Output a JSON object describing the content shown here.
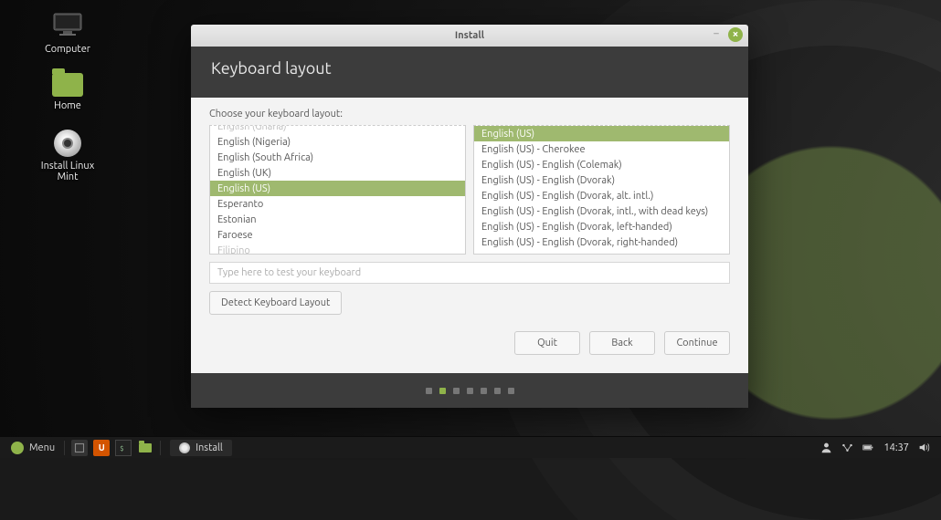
{
  "desktop": {
    "icons": [
      {
        "name": "computer",
        "label": "Computer"
      },
      {
        "name": "home",
        "label": "Home"
      },
      {
        "name": "install",
        "label": "Install Linux Mint"
      }
    ]
  },
  "window": {
    "title": "Install",
    "heading": "Keyboard layout",
    "prompt": "Choose your keyboard layout:",
    "layouts_left": [
      {
        "label": "English (Ghana)",
        "cut": true
      },
      {
        "label": "English (Nigeria)"
      },
      {
        "label": "English (South Africa)"
      },
      {
        "label": "English (UK)"
      },
      {
        "label": "English (US)",
        "selected": true
      },
      {
        "label": "Esperanto"
      },
      {
        "label": "Estonian"
      },
      {
        "label": "Faroese"
      },
      {
        "label": "Filipino",
        "cut": true
      }
    ],
    "layouts_right": [
      {
        "label": "English (US)",
        "selected": true
      },
      {
        "label": "English (US) - Cherokee"
      },
      {
        "label": "English (US) - English (Colemak)"
      },
      {
        "label": "English (US) - English (Dvorak)"
      },
      {
        "label": "English (US) - English (Dvorak, alt. intl.)"
      },
      {
        "label": "English (US) - English (Dvorak, intl., with dead keys)"
      },
      {
        "label": "English (US) - English (Dvorak, left-handed)"
      },
      {
        "label": "English (US) - English (Dvorak, right-handed)"
      }
    ],
    "test_placeholder": "Type here to test your keyboard",
    "detect_label": "Detect Keyboard Layout",
    "buttons": {
      "quit": "Quit",
      "back": "Back",
      "continue": "Continue"
    },
    "progress": {
      "total": 7,
      "active": 1
    }
  },
  "taskbar": {
    "menu": "Menu",
    "active_task": "Install",
    "time": "14:37"
  }
}
